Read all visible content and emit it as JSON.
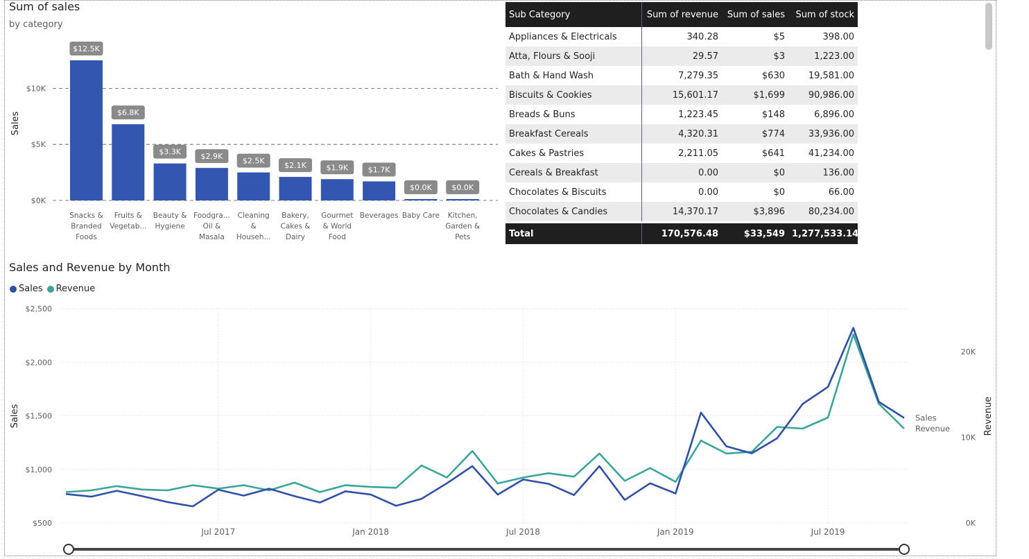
{
  "bar_visual": {
    "title": "Sum of sales",
    "subtitle": "by category"
  },
  "line_visual": {
    "title": "Sales and Revenue by Month",
    "legend": [
      {
        "label": "Sales",
        "color": "#2f4fa8"
      },
      {
        "label": "Revenue",
        "color": "#3aa69a"
      }
    ]
  },
  "table": {
    "headers": [
      "Sub Category",
      "Sum of revenue",
      "Sum of sales",
      "Sum of stock"
    ],
    "rows": [
      [
        "Appliances & Electricals",
        "340.28",
        "$5",
        "398.00"
      ],
      [
        "Atta, Flours & Sooji",
        "29.57",
        "$3",
        "1,223.00"
      ],
      [
        "Bath & Hand Wash",
        "7,279.35",
        "$630",
        "19,581.00"
      ],
      [
        "Biscuits & Cookies",
        "15,601.17",
        "$1,699",
        "90,986.00"
      ],
      [
        "Breads & Buns",
        "1,223.45",
        "$148",
        "6,896.00"
      ],
      [
        "Breakfast Cereals",
        "4,320.31",
        "$774",
        "33,936.00"
      ],
      [
        "Cakes & Pastries",
        "2,211.05",
        "$641",
        "41,234.00"
      ],
      [
        "Cereals & Breakfast",
        "0.00",
        "$0",
        "136.00"
      ],
      [
        "Chocolates & Biscuits",
        "0.00",
        "$0",
        "66.00"
      ],
      [
        "Chocolates & Candies",
        "14,370.17",
        "$3,896",
        "80,234.00"
      ]
    ],
    "total": [
      "Total",
      "170,576.48",
      "$33,549",
      "1,277,533.14"
    ]
  },
  "chart_data": [
    {
      "type": "bar",
      "title": "Sum of sales",
      "subtitle": "by category",
      "ylabel": "Sales",
      "ylim": [
        0,
        12500
      ],
      "yticks": [
        "$0K",
        "$5K",
        "$10K"
      ],
      "ytick_values": [
        0,
        5000,
        10000
      ],
      "grid": true,
      "categories": [
        [
          "Snacks &",
          "Branded",
          "Foods"
        ],
        [
          "Fruits &",
          "Vegetab..."
        ],
        [
          "Beauty &",
          "Hygiene"
        ],
        [
          "Foodgra...",
          "Oil &",
          "Masala"
        ],
        [
          "Cleaning",
          "&",
          "Househ..."
        ],
        [
          "Bakery,",
          "Cakes &",
          "Dairy"
        ],
        [
          "Gourmet",
          "& World",
          "Food"
        ],
        [
          "Beverages"
        ],
        [
          "Baby Care"
        ],
        [
          "Kitchen,",
          "Garden &",
          "Pets"
        ]
      ],
      "values": [
        12500,
        6800,
        3300,
        2900,
        2500,
        2100,
        1900,
        1700,
        20,
        20
      ],
      "data_labels": [
        "$12.5K",
        "$6.8K",
        "$3.3K",
        "$2.9K",
        "$2.5K",
        "$2.1K",
        "$1.9K",
        "$1.7K",
        "$0.0K",
        "$0.0K"
      ],
      "bar_color": "#3356b0",
      "label_bg": "#8a8a8a"
    },
    {
      "type": "line",
      "title": "Sales and Revenue by Month",
      "ylabel": "Sales",
      "y2label": "Revenue",
      "ylim": [
        500,
        2500
      ],
      "yticks": [
        "$500",
        "$1,000",
        "$1,500",
        "$2,000",
        "$2,500"
      ],
      "ytick_values": [
        500,
        1000,
        1500,
        2000,
        2500
      ],
      "y2lim": [
        0,
        25000
      ],
      "y2ticks": [
        "0K",
        "10K",
        "20K"
      ],
      "y2tick_values": [
        0,
        10000,
        20000
      ],
      "xlabels": [
        "Jul 2017",
        "Jan 2018",
        "Jul 2018",
        "Jan 2019",
        "Jul 2019"
      ],
      "xlabel_months": [
        "2017-07",
        "2018-01",
        "2018-07",
        "2019-01",
        "2019-07"
      ],
      "x": [
        "2017-01",
        "2017-02",
        "2017-03",
        "2017-04",
        "2017-05",
        "2017-06",
        "2017-07",
        "2017-08",
        "2017-09",
        "2017-10",
        "2017-11",
        "2017-12",
        "2018-01",
        "2018-02",
        "2018-03",
        "2018-04",
        "2018-05",
        "2018-06",
        "2018-07",
        "2018-08",
        "2018-09",
        "2018-10",
        "2018-11",
        "2018-12",
        "2019-01",
        "2019-02",
        "2019-03",
        "2019-04",
        "2019-05",
        "2019-06",
        "2019-07",
        "2019-08",
        "2019-09",
        "2019-10"
      ],
      "series": [
        {
          "name": "Sales",
          "axis": "left",
          "color": "#2f4fa8",
          "values": [
            770,
            745,
            800,
            750,
            695,
            655,
            810,
            755,
            820,
            750,
            690,
            795,
            765,
            660,
            725,
            870,
            1030,
            765,
            905,
            865,
            760,
            1030,
            715,
            870,
            775,
            1530,
            1215,
            1150,
            1290,
            1610,
            1770,
            2320,
            1630,
            1480
          ]
        },
        {
          "name": "Revenue",
          "axis": "right",
          "color": "#3aa69a",
          "values": [
            3600,
            3800,
            4300,
            3900,
            3800,
            4400,
            4000,
            4400,
            3800,
            4700,
            3600,
            4400,
            4200,
            4100,
            6700,
            5300,
            8400,
            4600,
            5300,
            5800,
            5400,
            8100,
            4900,
            6400,
            4800,
            9600,
            8100,
            8300,
            11200,
            11000,
            12300,
            22000,
            13900,
            11000
          ]
        }
      ]
    }
  ]
}
